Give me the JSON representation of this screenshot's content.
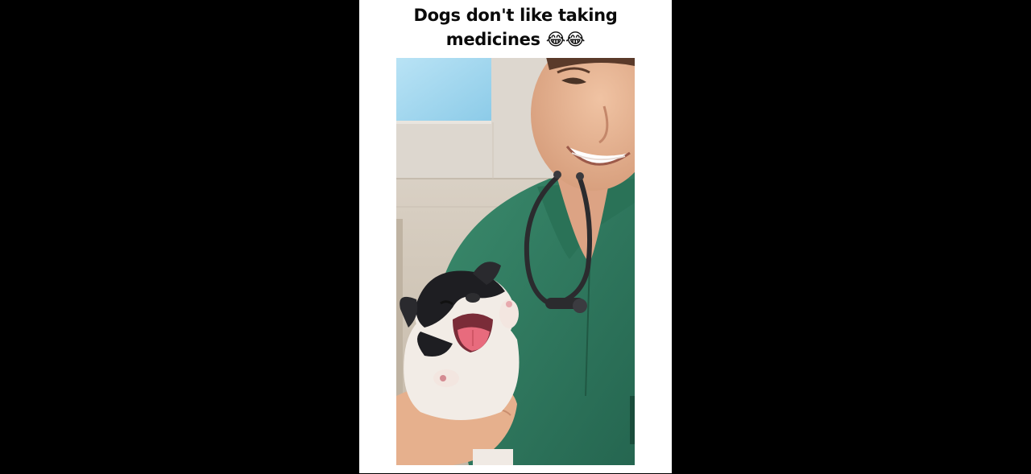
{
  "caption": {
    "line1": "Dogs don't like taking",
    "line2": "medicines 😂😂"
  },
  "photo": {
    "alt": "Vet in green scrubs with stethoscope holding a crying French bulldog puppy",
    "colors": {
      "wall": "#d7cfc4",
      "ceiling_light": "#a9d8ef",
      "scrubs": "#2f7a5e",
      "skin": "#e6b08d",
      "puppy_white": "#f2ece6",
      "puppy_black": "#1e1e22",
      "tongue": "#e86b7d"
    }
  }
}
